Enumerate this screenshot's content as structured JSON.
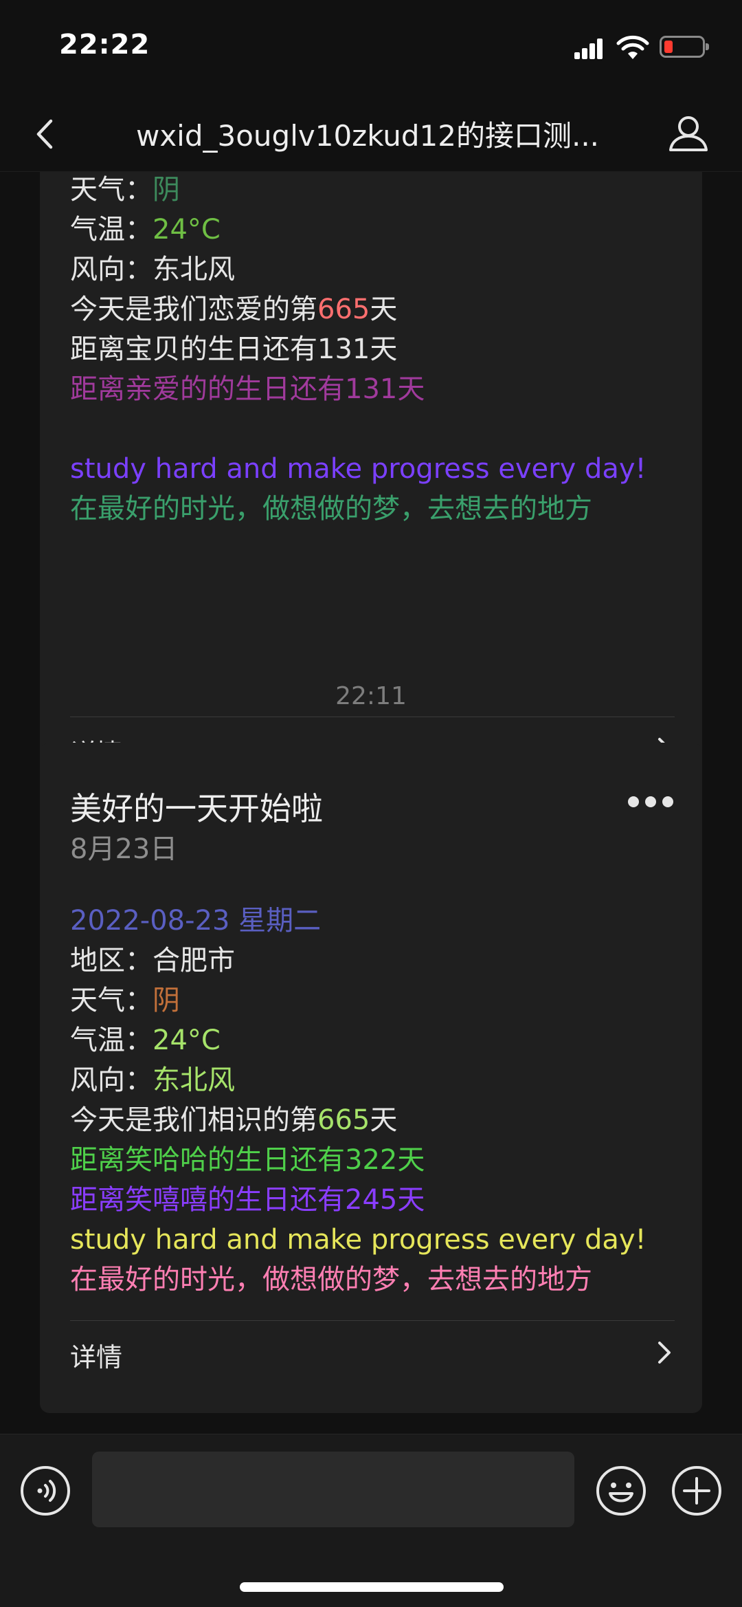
{
  "status": {
    "time": "22:22"
  },
  "nav": {
    "title": "wxid_3ouglv10zkud12的接口测..."
  },
  "messages": [
    {
      "lines": [
        {
          "label": "天气：",
          "value": "阴",
          "color": "#3d8a5c"
        },
        {
          "label": "气温：",
          "value": "24°C",
          "color": "#6fbf44"
        },
        {
          "label": "风向：",
          "value": "东北风",
          "color": "#e6e6e6"
        },
        {
          "text": "今天是我们恋爱的第",
          "value": "665",
          "suffix": "天",
          "color": "#ff6f6f"
        },
        {
          "text": "距离宝贝的生日还有131天",
          "color": "#e6e6e6"
        },
        {
          "text": "距离亲爱的的生日还有131天",
          "color": "#a03a9c"
        },
        {
          "text": "",
          "color": "#e6e6e6"
        },
        {
          "text": "study hard and make progress every day!",
          "color": "#7b40ff"
        },
        {
          "text": "在最好的时光，做想做的梦，去想去的地方",
          "color": "#3aa06c"
        }
      ],
      "detail": "详情"
    },
    {
      "title": "美好的一天开始啦",
      "date": "8月23日",
      "lines": [
        {
          "text": "2022-08-23 星期二",
          "color": "#5a5fc2"
        },
        {
          "label": "地区：",
          "value": "合肥市",
          "color": "#e6e6e6"
        },
        {
          "label": "天气：",
          "value": "阴",
          "color": "#c2703a"
        },
        {
          "label": "气温：",
          "value": "24°C",
          "color": "#a6e36a"
        },
        {
          "label": "风向：",
          "value": "东北风",
          "color": "#a6e36a"
        },
        {
          "text": "今天是我们相识的第",
          "value": "665",
          "suffix": "天",
          "color": "#a6e36a"
        },
        {
          "text": "距离笑哈哈的生日还有322天",
          "color": "#4fd04a"
        },
        {
          "text": "距离笑嘻嘻的生日还有245天",
          "color": "#8a3dff"
        },
        {
          "text": "study hard and make progress every day!",
          "color": "#e6e65a"
        },
        {
          "text": "在最好的时光，做想做的梦，去想去的地方",
          "color": "#ff7fb3"
        }
      ],
      "detail": "详情"
    }
  ],
  "timestamp": "22:11",
  "icons": {
    "back": "chevron-left-icon",
    "profile": "person-icon",
    "more": "ellipsis-icon",
    "arrow": "chevron-right-icon",
    "voice": "voice-icon",
    "emoji": "emoji-icon",
    "plus": "plus-icon"
  }
}
